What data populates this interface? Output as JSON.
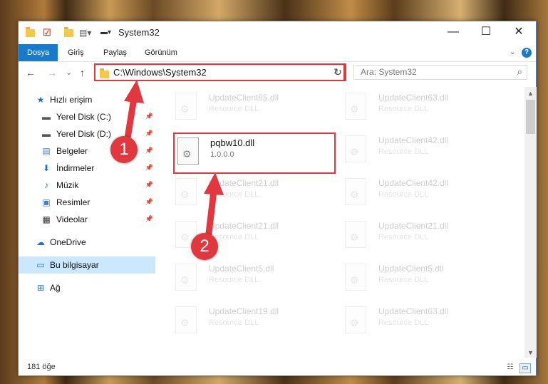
{
  "window": {
    "title": "System32",
    "controls": {
      "minimize": "—",
      "maximize": "☐",
      "close": "✕"
    }
  },
  "ribbon": {
    "tabs": [
      {
        "label": "Dosya",
        "active": true
      },
      {
        "label": "Giriş"
      },
      {
        "label": "Paylaş"
      },
      {
        "label": "Görünüm"
      }
    ],
    "collapse": "⌄",
    "help": "?"
  },
  "nav": {
    "back": "←",
    "forward": "→",
    "recent": "⌄",
    "up": "↑",
    "address": "C:\\Windows\\System32",
    "address_dropdown": "⌄",
    "refresh": "↻",
    "search_placeholder": "Ara: System32",
    "search_icon": "⌕"
  },
  "sidebar": {
    "items": [
      {
        "label": "Hızlı erişim",
        "icon": "star-icon",
        "glyph": "★",
        "color": "#1e73c8"
      },
      {
        "label": "Yerel Disk (C:)",
        "icon": "drive-icon",
        "glyph": "▬",
        "color": "#555555",
        "pinned": true
      },
      {
        "label": "Yerel Disk (D:)",
        "icon": "drive-icon",
        "glyph": "▬",
        "color": "#555555",
        "pinned": true
      },
      {
        "label": "Belgeler",
        "icon": "documents-icon",
        "glyph": "▤",
        "color": "#4a7fc1",
        "pinned": true
      },
      {
        "label": "İndirmeler",
        "icon": "downloads-icon",
        "glyph": "⬇",
        "color": "#1e73c8",
        "pinned": true
      },
      {
        "label": "Müzik",
        "icon": "music-icon",
        "glyph": "♪",
        "color": "#1e73c8",
        "pinned": true
      },
      {
        "label": "Resimler",
        "icon": "pictures-icon",
        "glyph": "▣",
        "color": "#4a7fc1",
        "pinned": true
      },
      {
        "label": "Videolar",
        "icon": "videos-icon",
        "glyph": "▦",
        "color": "#333333",
        "pinned": true
      },
      {
        "label": "OneDrive",
        "icon": "cloud-icon",
        "glyph": "☁",
        "color": "#1e73c8"
      },
      {
        "label": "Bu bilgisayar",
        "icon": "computer-icon",
        "glyph": "▭",
        "color": "#1e73c8",
        "selected": true
      },
      {
        "label": "Ağ",
        "icon": "network-icon",
        "glyph": "⊞",
        "color": "#1e73c8"
      }
    ],
    "pin_glyph": "📌"
  },
  "files": {
    "left_column": [
      {
        "name": "UpdateClient65.dll",
        "desc": "Resource DLL"
      },
      {
        "name": "UpdateClient21.dll",
        "desc": "Resource DLL"
      },
      {
        "name": "UpdateClient21.dll",
        "desc": "Resource DLL"
      },
      {
        "name": "UpdateClient5.dll",
        "desc": "Resource DLL"
      },
      {
        "name": "UpdateClient19.dll",
        "desc": "Resource DLL"
      }
    ],
    "right_column": [
      {
        "name": "UpdateClient63.dll",
        "desc": "Resource DLL"
      },
      {
        "name": "UpdateClient42.dll",
        "desc": "Resource DLL"
      },
      {
        "name": "UpdateClient42.dll",
        "desc": "Resource DLL"
      },
      {
        "name": "UpdateClient21.dll",
        "desc": "Resource DLL"
      },
      {
        "name": "UpdateClient5.dll",
        "desc": "Resource DLL"
      },
      {
        "name": "UpdateClient63.dll",
        "desc": "Resource DLL"
      }
    ],
    "highlighted": {
      "name": "pqbw10.dll",
      "desc": "1.0.0.0"
    }
  },
  "status": {
    "count": "181 öğe"
  },
  "annotations": {
    "step1": "1",
    "step2": "2",
    "color": "#e0383e"
  }
}
